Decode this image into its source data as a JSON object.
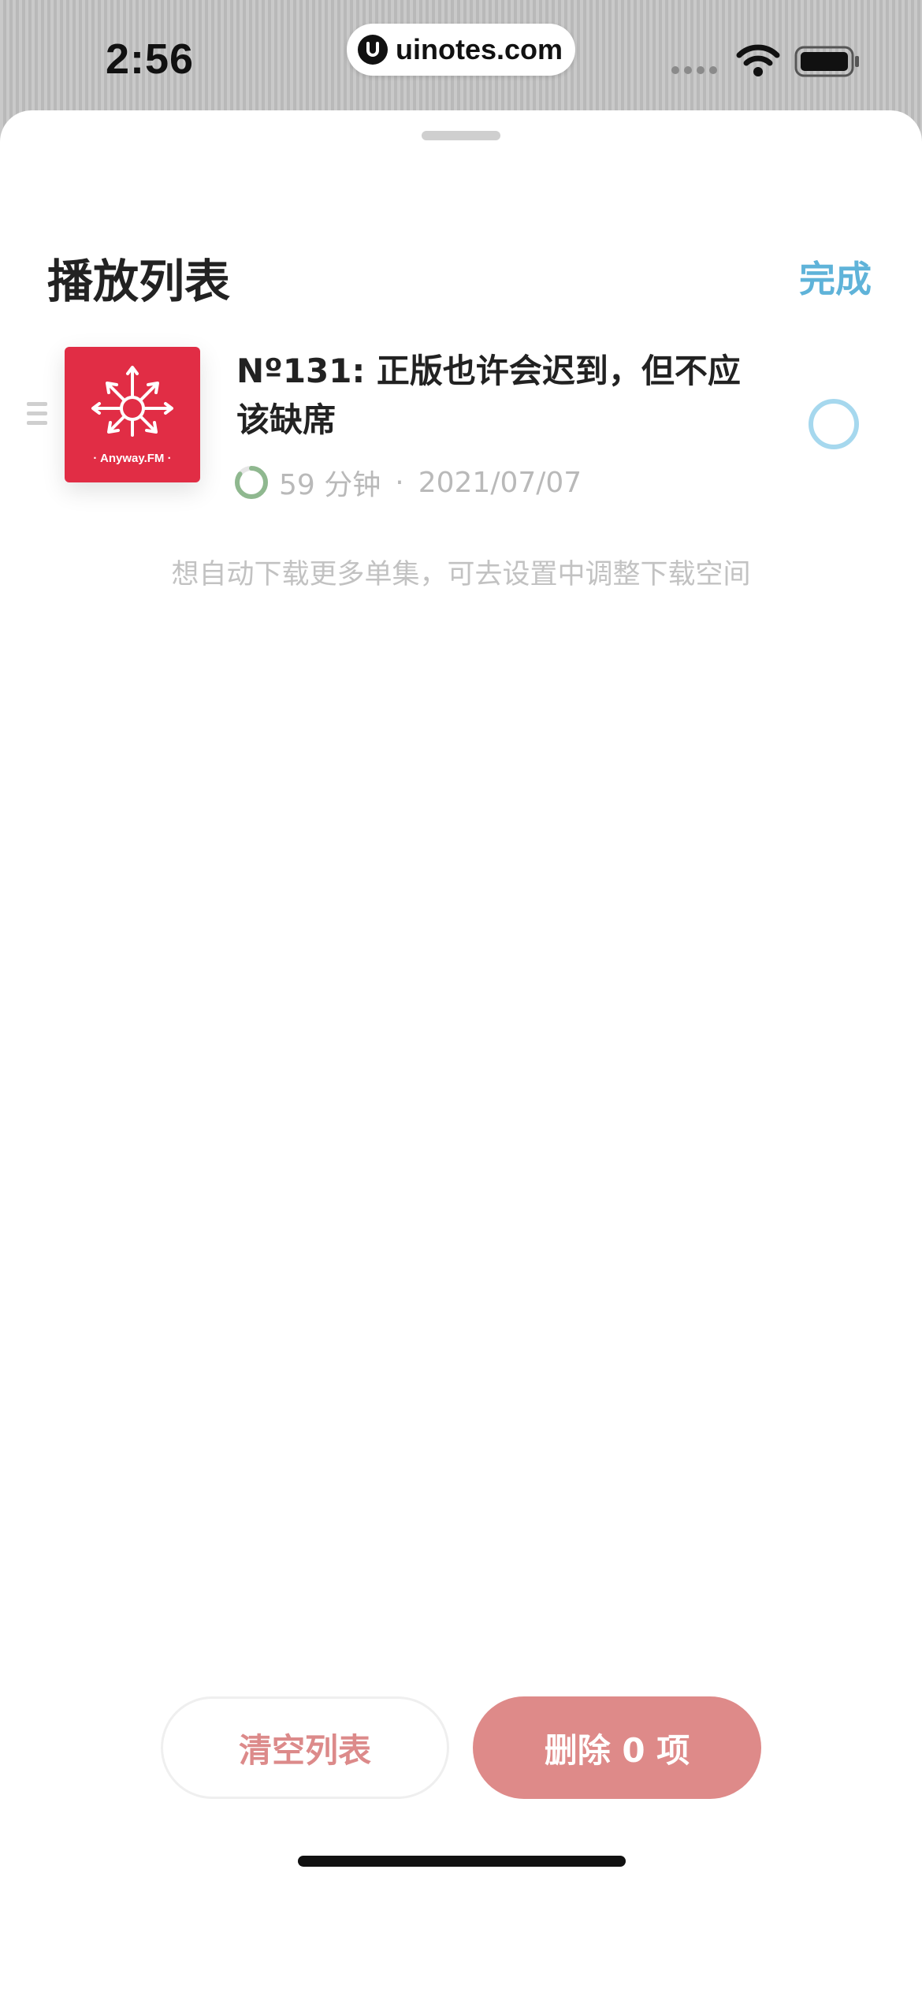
{
  "status_bar": {
    "time": "2:56",
    "url": "uinotes.com"
  },
  "sheet": {
    "title": "播放列表",
    "done_label": "完成"
  },
  "episode": {
    "title": "Nº131: 正版也许会迟到，但不应该缺席",
    "duration": "59 分钟",
    "separator": "·",
    "date": "2021/07/07",
    "cover_label": "· Anyway.FM ·",
    "progress_fraction": 0.85,
    "selected": false
  },
  "hint": "想自动下载更多单集，可去设置中调整下载空间",
  "actions": {
    "clear_label": "清空列表",
    "delete_label": "删除 0 项"
  },
  "colors": {
    "accent_blue": "#5fb3d9",
    "select_ring": "#a6d8ee",
    "danger_soft": "#de8a89",
    "progress_green": "#8fb88f",
    "cover_red": "#e12d45"
  }
}
